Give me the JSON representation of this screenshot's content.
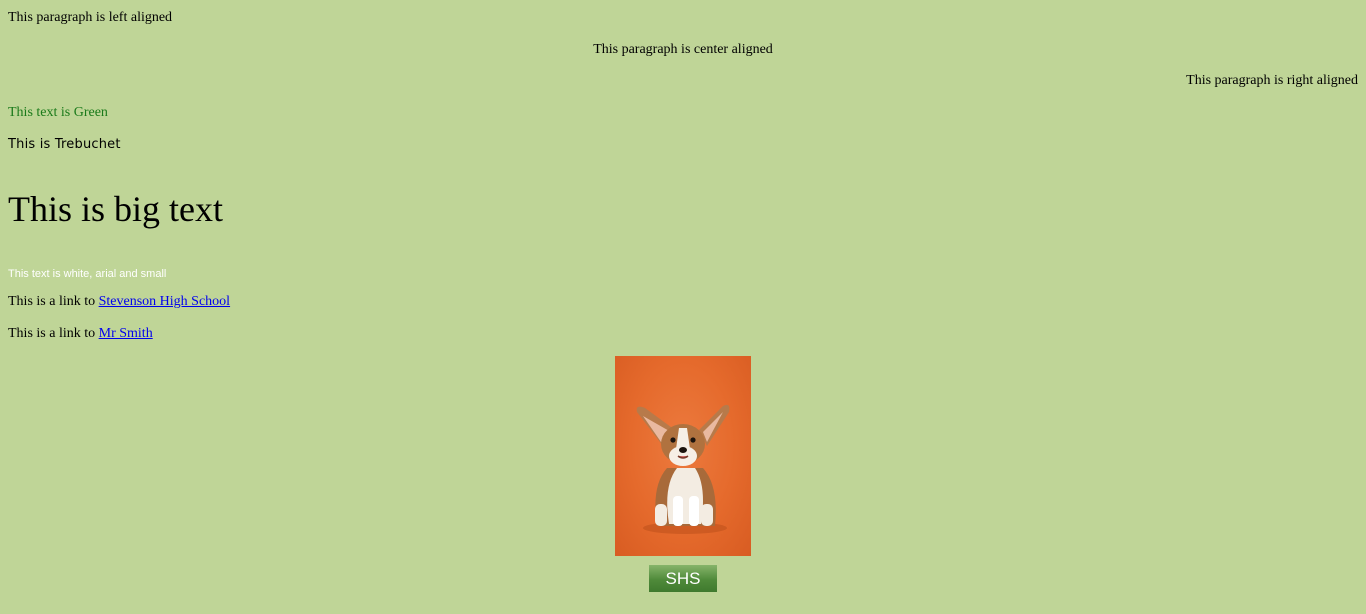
{
  "paragraphs": {
    "left": "This paragraph is left aligned",
    "center": "This paragraph is center aligned",
    "right": "This paragraph is right aligned",
    "green": "This text is Green",
    "trebuchet": "This is Trebuchet",
    "big": "This is big text",
    "small_white": "This text is white, arial and small"
  },
  "links": [
    {
      "prefix": "This is a link to ",
      "text": "Stevenson High School"
    },
    {
      "prefix": "This is a link to ",
      "text": "Mr Smith"
    }
  ],
  "button": {
    "label": "SHS"
  },
  "colors": {
    "background": "#bfd597",
    "green_text": "#1a7a1a",
    "link": "#0000ee",
    "button": "#5a9a44",
    "photo_backdrop": "#e56a2c"
  },
  "image": {
    "subject": "corgi puppy on orange background"
  }
}
